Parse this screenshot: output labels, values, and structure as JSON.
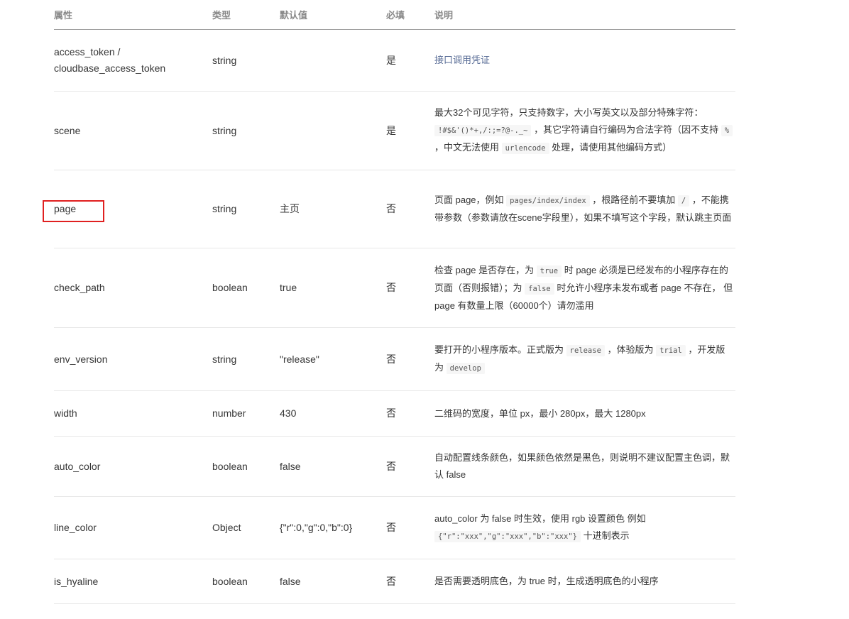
{
  "table": {
    "headers": {
      "attr": "属性",
      "type": "类型",
      "default": "默认值",
      "required": "必填",
      "desc": "说明"
    },
    "rows": {
      "access_token": {
        "name_1": "access_token /",
        "name_2": "cloudbase_access_token",
        "type": "string",
        "default": "",
        "required": "是",
        "desc": "接口调用凭证"
      },
      "scene": {
        "name": "scene",
        "type": "string",
        "default": "",
        "required": "是",
        "desc_1": "最大32个可见字符，只支持数字，大小写英文以及部分特殊字符：",
        "code_1": "!#$&'()*+,/:;=?@-._~",
        "desc_2": "，其它字符请自行编码为合法字符（因不支持",
        "code_2": "%",
        "desc_3": "，中文无法使用",
        "code_3": "urlencode",
        "desc_4": "处理，请使用其他编码方式）"
      },
      "page": {
        "name": "page",
        "type": "string",
        "default": "主页",
        "required": "否",
        "desc_1": "页面 page，例如",
        "code_1": "pages/index/index",
        "desc_2": "，根路径前不要填加",
        "code_2": "/",
        "desc_3": "，不能携带参数（参数请放在scene字段里），如果不填写这个字段，默认跳主页面"
      },
      "check_path": {
        "name": "check_path",
        "type": "boolean",
        "default": "true",
        "required": "否",
        "desc_1": "检查 page 是否存在，为",
        "code_1": "true",
        "desc_2": "时 page 必须是已经发布的小程序存在的页面（否则报错）；为",
        "code_2": "false",
        "desc_3": "时允许小程序未发布或者 page 不存在， 但 page 有数量上限（60000个）请勿滥用"
      },
      "env_version": {
        "name": "env_version",
        "type": "string",
        "default": "\"release\"",
        "required": "否",
        "desc_1": "要打开的小程序版本。正式版为",
        "code_1": "release",
        "desc_2": "，体验版为",
        "code_2": "trial",
        "desc_3": "，开发版为",
        "code_3": "develop"
      },
      "width": {
        "name": "width",
        "type": "number",
        "default": "430",
        "required": "否",
        "desc": "二维码的宽度，单位 px，最小 280px，最大 1280px"
      },
      "auto_color": {
        "name": "auto_color",
        "type": "boolean",
        "default": "false",
        "required": "否",
        "desc": "自动配置线条颜色，如果颜色依然是黑色，则说明不建议配置主色调，默认 false"
      },
      "line_color": {
        "name": "line_color",
        "type": "Object",
        "default": "{\"r\":0,\"g\":0,\"b\":0}",
        "required": "否",
        "desc_1": "auto_color 为 false 时生效，使用 rgb 设置颜色 例如",
        "code_1": "{\"r\":\"xxx\",\"g\":\"xxx\",\"b\":\"xxx\"}",
        "desc_2": "十进制表示"
      },
      "is_hyaline": {
        "name": "is_hyaline",
        "type": "boolean",
        "default": "false",
        "required": "否",
        "desc": "是否需要透明底色，为 true 时，生成透明底色的小程序"
      }
    }
  },
  "colors": {
    "highlight": "#e02020",
    "link": "#576b95",
    "header_text": "#888888"
  }
}
